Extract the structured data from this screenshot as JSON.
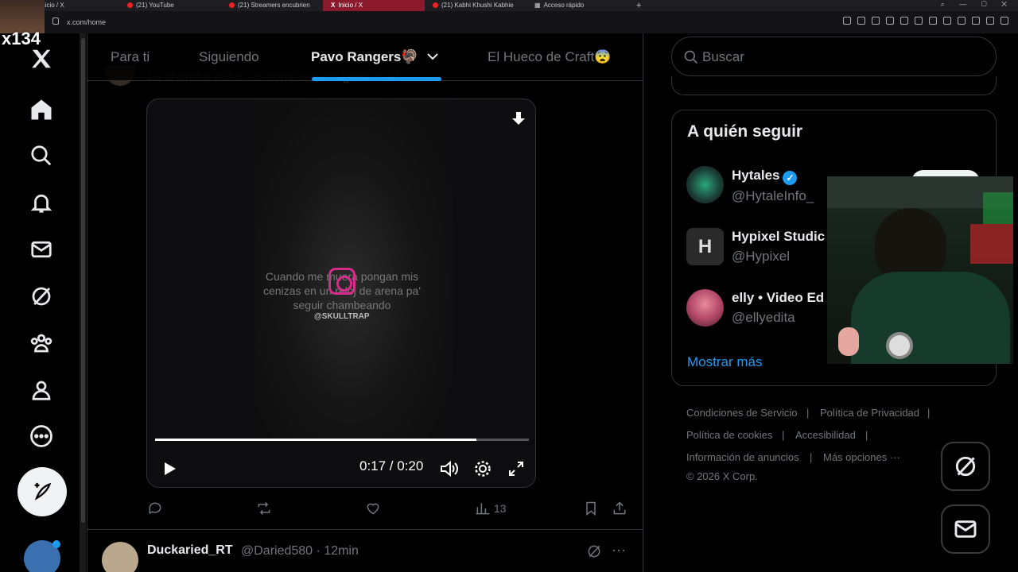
{
  "browser": {
    "tabs": [
      {
        "label": "Inicio / X",
        "active": false
      },
      {
        "label": "(21) YouTube",
        "active": false
      },
      {
        "label": "(21) Streamers encubrien",
        "active": false
      },
      {
        "label": "Inicio / X",
        "active": true
      },
      {
        "label": "(21) Kabhi Khushi Kabhie",
        "active": false
      },
      {
        "label": "Acceso rápido",
        "active": false
      }
    ],
    "url": "x.com/home"
  },
  "overlay": {
    "label": "x134"
  },
  "timeline_tabs": [
    {
      "label": "Para ti"
    },
    {
      "label": "Siguiendo"
    },
    {
      "label": "Pavo Rangers🦃",
      "active": true
    },
    {
      "label": "El Hueco de Craft😨"
    }
  ],
  "post": {
    "text": "La chamba debe ser constante mi guaton 20.",
    "video": {
      "caption": "Cuando me muera pongan mis cenizas en un reloj de arena pa' seguir chambeando",
      "watermark": "@SKULLTRAP",
      "time": "0:17 / 0:20",
      "progress": 0.86
    },
    "views": "13"
  },
  "next_post": {
    "name": "Duckaried_RT",
    "handle": "@Daried580",
    "time": "· 12min"
  },
  "sidebar": {
    "search_placeholder": "Buscar",
    "who_to_follow": {
      "title": "A quién seguir",
      "suggestions": [
        {
          "name": "Hytales",
          "handle": "@HytaleInfo_",
          "verified": true
        },
        {
          "name": "Hypixel Studic",
          "handle": "@Hypixel",
          "verified": false
        },
        {
          "name": "elly • Video Ed",
          "handle": "@ellyedita",
          "verified": false
        }
      ],
      "show_more": "Mostrar más"
    },
    "footer": {
      "terms": "Condiciones de Servicio",
      "privacy": "Política de Privacidad",
      "cookies": "Política de cookies",
      "accessibility": "Accesibilidad",
      "ads": "Información de anuncios",
      "more": "Más opciones ···",
      "copyright": "© 2026 X Corp."
    }
  },
  "colors": {
    "accent": "#1d9bf0",
    "background": "#000000",
    "border": "#2f3336",
    "muted_text": "#71767b"
  }
}
